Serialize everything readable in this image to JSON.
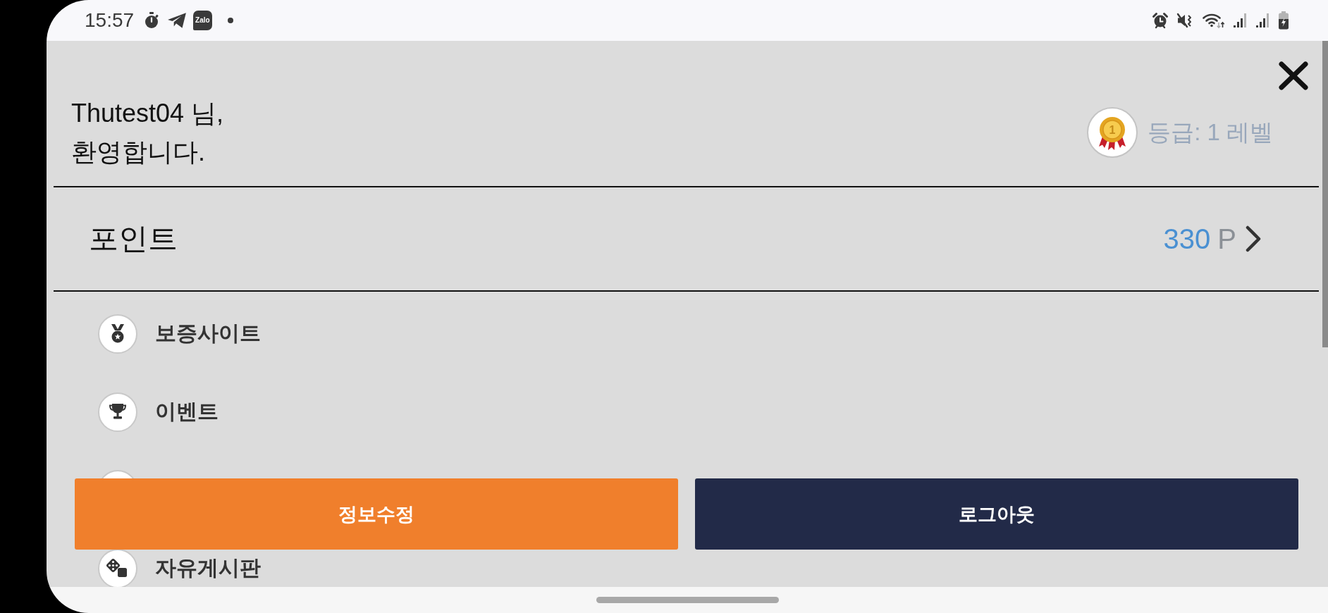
{
  "status_bar": {
    "time": "15:57",
    "app_icon_label": "Zalo"
  },
  "header": {
    "greeting": "Thutest04 님,\n환영합니다.",
    "level": {
      "medal_number": "1",
      "label": "등급: 1 레벨"
    }
  },
  "points": {
    "title": "포인트",
    "amount": "330",
    "unit": "P"
  },
  "menu": {
    "items": [
      {
        "kind": "link",
        "label": "보증사이트"
      },
      {
        "kind": "link",
        "label": "이벤트"
      },
      {
        "kind": "covered"
      },
      {
        "kind": "link",
        "label": "자유게시판"
      }
    ]
  },
  "buttons": [
    {
      "kind": "primary",
      "label": "정보수정"
    },
    {
      "kind": "secondary",
      "label": "로그아웃"
    }
  ]
}
